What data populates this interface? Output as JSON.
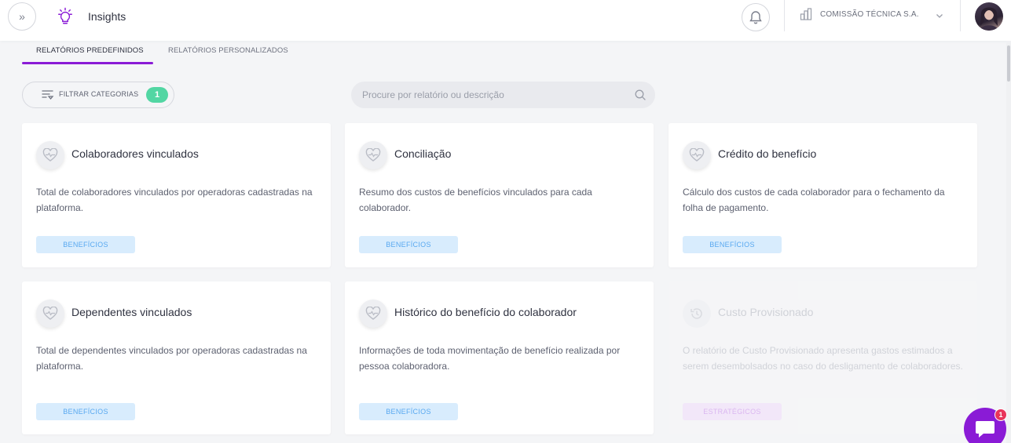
{
  "header": {
    "app_title": "Insights",
    "company_name": "COMISSÃO TÉCNICA S.A.",
    "icons": [
      "expand-icon",
      "lightbulb-icon",
      "bell-icon",
      "building-icon",
      "chevron-down-icon",
      "avatar"
    ]
  },
  "tabs": [
    {
      "label": "RELATÓRIOS PREDEFINIDOS",
      "active": true
    },
    {
      "label": "RELATÓRIOS PERSONALIZADOS",
      "active": false
    }
  ],
  "filter": {
    "label": "FILTRAR CATEGORIAS",
    "count": "1"
  },
  "search": {
    "placeholder": "Procure por relatório ou descrição"
  },
  "cards": [
    {
      "title": "Colaboradores vinculados",
      "description": "Total de colaboradores vinculados por operadoras cadastradas na plataforma.",
      "tag": "BENEFÍCIOS",
      "icon": "heart-pulse-icon"
    },
    {
      "title": "Conciliação",
      "description": "Resumo dos custos de benefícios vinculados para cada colaborador.",
      "tag": "BENEFÍCIOS",
      "icon": "heart-pulse-icon"
    },
    {
      "title": "Crédito do benefício",
      "description": "Cálculo dos custos de cada colaborador para o fechamento da folha de pagamento.",
      "tag": "BENEFÍCIOS",
      "icon": "heart-pulse-icon"
    },
    {
      "title": "Dependentes vinculados",
      "description": "Total de dependentes vinculados por operadoras cadastradas na plataforma.",
      "tag": "BENEFÍCIOS",
      "icon": "heart-pulse-icon"
    },
    {
      "title": "Histórico do benefício do colaborador",
      "description": "Informações de toda movimentação de benefício realizada por pessoa colaboradora.",
      "tag": "BENEFÍCIOS",
      "icon": "heart-pulse-icon"
    },
    {
      "title": "Custo Provisionado",
      "description": "O relatório de Custo Provisionado apresenta gastos estimados a serem desembolsados no caso do desligamento de colaboradores.",
      "tag": "ESTRATÉGICOS",
      "icon": "history-icon"
    }
  ],
  "chat": {
    "badge_count": "1"
  },
  "colors": {
    "accent": "#8a1bd6",
    "badge_green": "#52d6a3",
    "tag_benefits_bg": "#d8ecfd",
    "tag_benefits_text": "#58a8f0",
    "tag_strategic_bg": "#f2ddfb",
    "notification_red": "#e8345a"
  }
}
